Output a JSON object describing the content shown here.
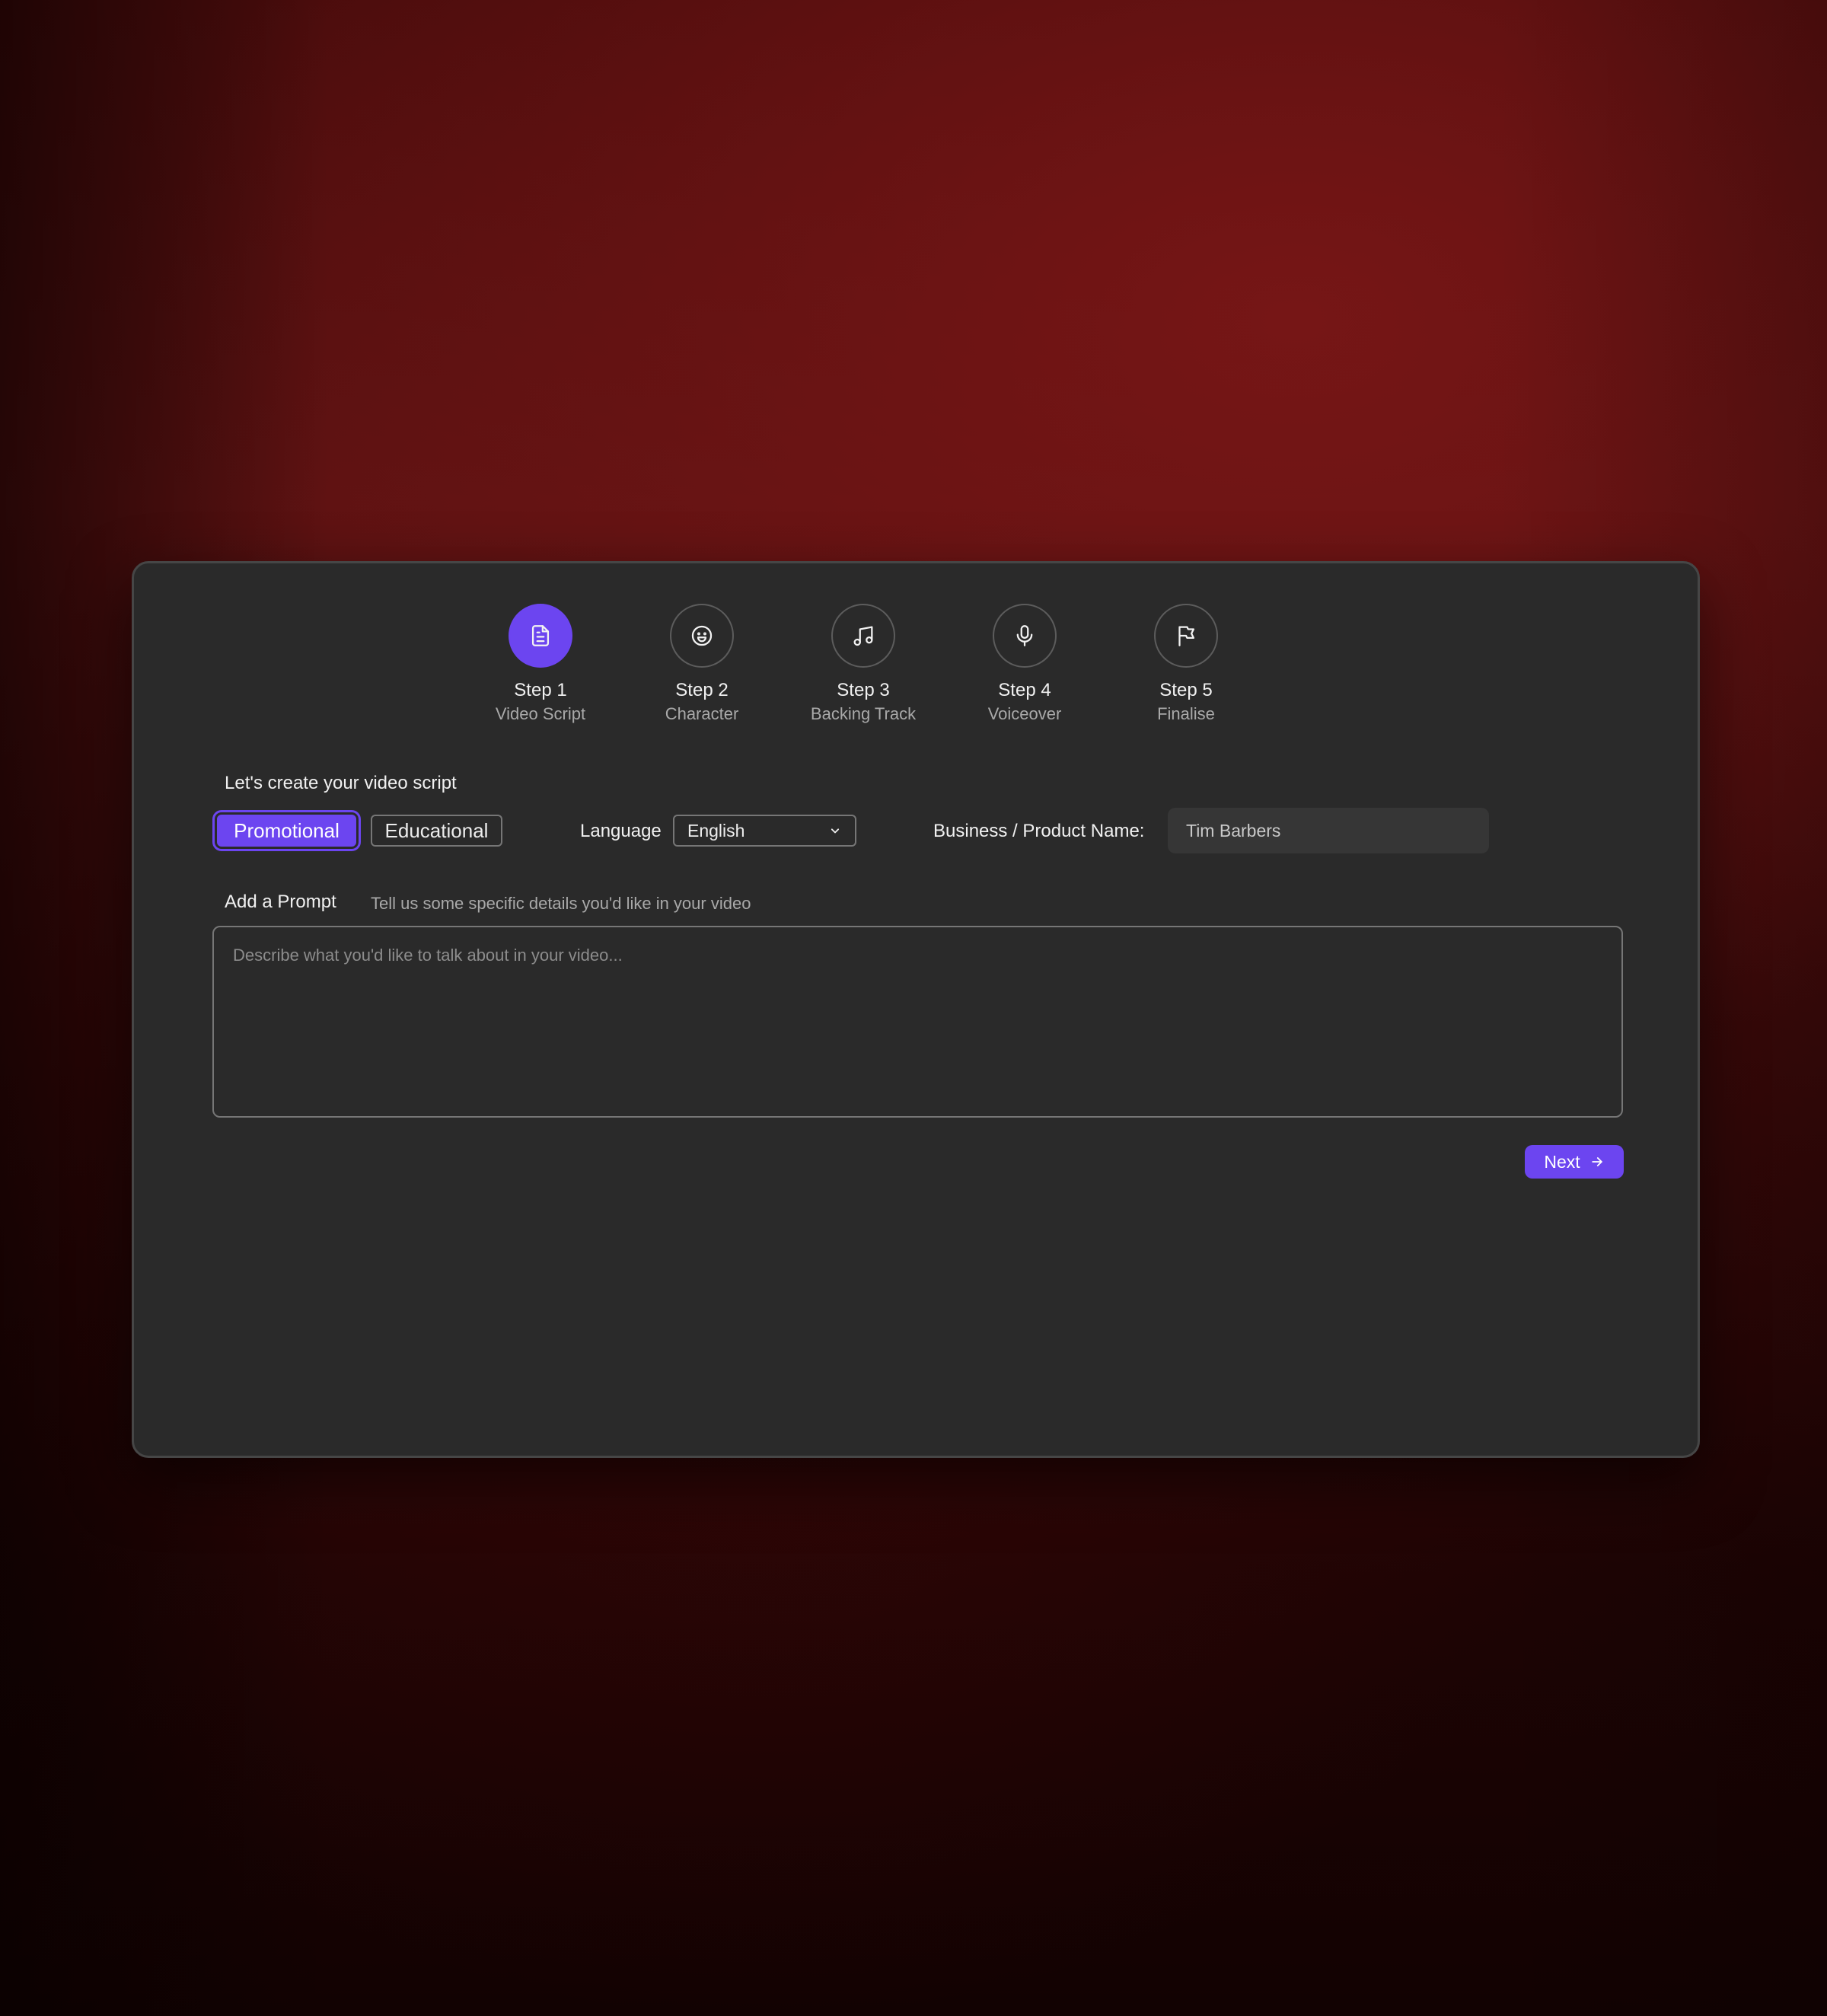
{
  "stepper": {
    "steps": [
      {
        "title": "Step 1",
        "subtitle": "Video Script",
        "icon": "document-icon",
        "active": true
      },
      {
        "title": "Step 2",
        "subtitle": "Character",
        "icon": "smiley-face-icon",
        "active": false
      },
      {
        "title": "Step 3",
        "subtitle": "Backing Track",
        "icon": "music-note-icon",
        "active": false
      },
      {
        "title": "Step 4",
        "subtitle": "Voiceover",
        "icon": "microphone-icon",
        "active": false
      },
      {
        "title": "Step 5",
        "subtitle": "Finalise",
        "icon": "flag-icon",
        "active": false
      }
    ]
  },
  "form": {
    "intro_label": "Let's create your video script",
    "video_types": [
      {
        "label": "Promotional",
        "selected": true
      },
      {
        "label": "Educational",
        "selected": false
      }
    ],
    "language": {
      "label": "Language",
      "value": "English",
      "icon": "chevron-down-icon"
    },
    "business": {
      "label": "Business / Product Name:",
      "value": "Tim Barbers"
    },
    "prompt": {
      "label": "Add a Prompt",
      "hint": "Tell us some specific details you'd like in your video",
      "placeholder": "Describe what you'd like to talk about in your video...",
      "value": ""
    },
    "next_label": "Next",
    "next_icon": "arrow-right-icon"
  },
  "colors": {
    "accent": "#6c45f0",
    "card_background": "#2a2a2a",
    "page_background": "#5d1212"
  }
}
